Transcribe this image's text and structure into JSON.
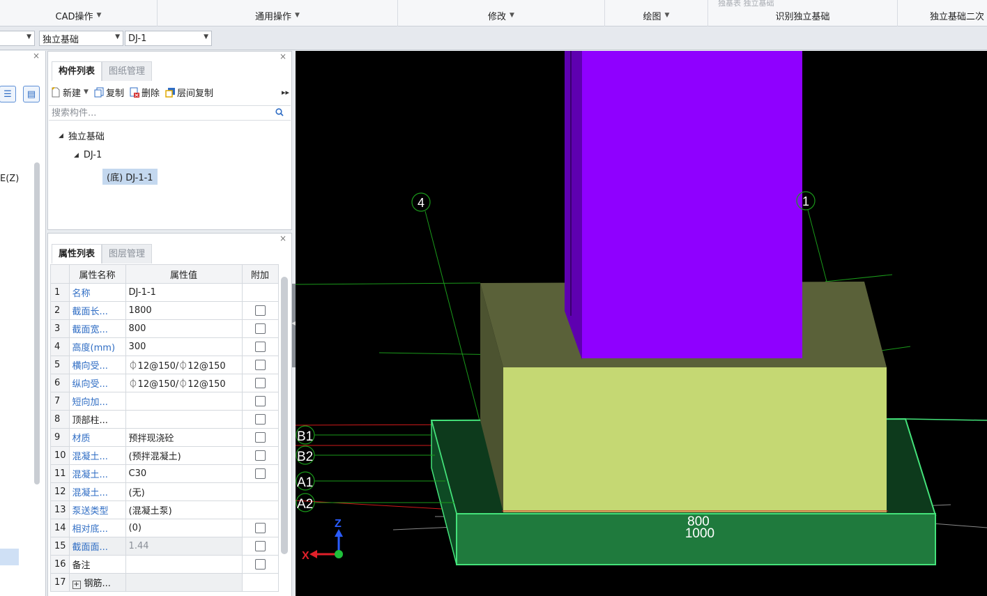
{
  "ribbon": {
    "groups": [
      {
        "label": "CAD操作",
        "dropdown": true
      },
      {
        "label": "通用操作",
        "dropdown": true
      },
      {
        "label": "修改",
        "dropdown": true
      },
      {
        "label": "绘图",
        "dropdown": true
      },
      {
        "label": "识别独立基础",
        "dropdown": false
      },
      {
        "label": "独立基础二次",
        "dropdown": false
      }
    ],
    "faded_text": "独基表  独立基础"
  },
  "selectors": {
    "first": "",
    "type": "独立基础",
    "component": "DJ-1"
  },
  "left_panel": {
    "partial_text": "E(Z)"
  },
  "component_panel": {
    "tabs": [
      "构件列表",
      "图纸管理"
    ],
    "toolbar": {
      "new": "新建",
      "copy": "复制",
      "delete": "删除",
      "floor_copy": "层间复制"
    },
    "search_placeholder": "搜索构件...",
    "tree": {
      "root": "独立基础",
      "child": "DJ-1",
      "leaf": "(底) DJ-1-1"
    }
  },
  "property_panel": {
    "tabs": [
      "属性列表",
      "图层管理"
    ],
    "headers": [
      "属性名称",
      "属性值",
      "附加"
    ],
    "rows": [
      {
        "no": "1",
        "name": "名称",
        "value": "DJ-1-1",
        "checkbox": false,
        "blue": true
      },
      {
        "no": "2",
        "name": "截面长...",
        "value": "1800",
        "checkbox": true,
        "blue": true
      },
      {
        "no": "3",
        "name": "截面宽...",
        "value": "800",
        "checkbox": true,
        "blue": true
      },
      {
        "no": "4",
        "name": "高度(mm)",
        "value": "300",
        "checkbox": true,
        "blue": true
      },
      {
        "no": "5",
        "name": "横向受...",
        "value": "⏀12@150/⏀12@150",
        "checkbox": true,
        "blue": true
      },
      {
        "no": "6",
        "name": "纵向受...",
        "value": "⏀12@150/⏀12@150",
        "checkbox": true,
        "blue": true
      },
      {
        "no": "7",
        "name": "短向加...",
        "value": "",
        "checkbox": true,
        "blue": true
      },
      {
        "no": "8",
        "name": "顶部柱...",
        "value": "",
        "checkbox": true,
        "blue": false
      },
      {
        "no": "9",
        "name": "材质",
        "value": "预拌现浇砼",
        "checkbox": true,
        "blue": true
      },
      {
        "no": "10",
        "name": "混凝土...",
        "value": "(预拌混凝土)",
        "checkbox": true,
        "blue": true
      },
      {
        "no": "11",
        "name": "混凝土...",
        "value": "C30",
        "checkbox": true,
        "blue": true
      },
      {
        "no": "12",
        "name": "混凝土...",
        "value": "(无)",
        "checkbox": false,
        "blue": true
      },
      {
        "no": "13",
        "name": "泵送类型",
        "value": "(混凝土泵)",
        "checkbox": false,
        "blue": true
      },
      {
        "no": "14",
        "name": "相对底...",
        "value": "(0)",
        "checkbox": true,
        "blue": true
      },
      {
        "no": "15",
        "name": "截面面...",
        "value": "1.44",
        "checkbox": true,
        "blue": true,
        "gray": true
      },
      {
        "no": "16",
        "name": "备注",
        "value": "",
        "checkbox": true,
        "blue": false
      },
      {
        "no": "17",
        "name": "钢筋...",
        "value": "",
        "checkbox": false,
        "blue": false,
        "expand": true,
        "gray": true
      }
    ]
  },
  "viewport": {
    "axis_labels": [
      "4",
      "1",
      "B1",
      "B2",
      "A1",
      "A2"
    ],
    "dimension_labels": [
      "800",
      "1000"
    ],
    "triad": {
      "z": "Z",
      "x": "X"
    },
    "colors": {
      "background": "#000000",
      "column": "#8f00ff",
      "pedestal_front": "#c5d873",
      "pedestal_top": "#5a6139",
      "footing": "#1f7a3d",
      "footing_edge": "#44e27a",
      "axis_line": "#1a9a1a",
      "red_line": "#d11a1a"
    }
  }
}
